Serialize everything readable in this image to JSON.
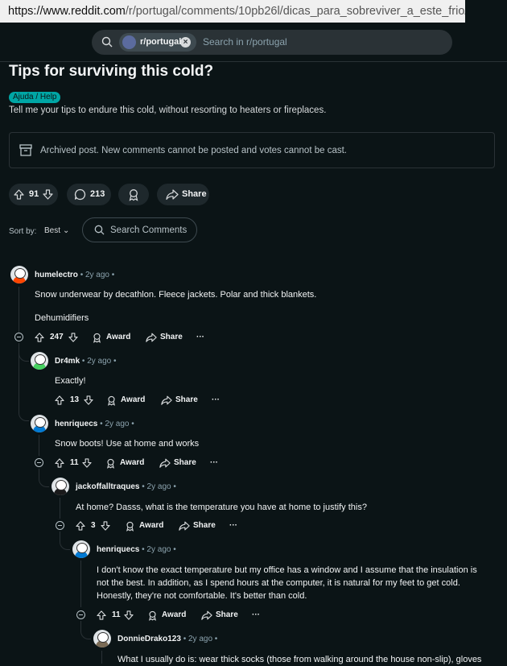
{
  "browser": {
    "url_host": "https://www.reddit.com",
    "url_path": "/r/portugal/comments/10pb26l/dicas_para_sobreviver_a_este_frio/"
  },
  "header": {
    "community": "r/portugal",
    "search_placeholder": "Search in r/portugal"
  },
  "post": {
    "title": "Tips for surviving this cold?",
    "flair": "Ajuda / Help",
    "body": "Tell me your tips to endure this cold, without resorting to heaters or fireplaces.",
    "archived_notice": "Archived post. New comments cannot be posted and votes cannot be cast.",
    "votes": "91",
    "comments": "213",
    "share_label": "Share"
  },
  "sort": {
    "label": "Sort by:",
    "value": "Best",
    "search_placeholder": "Search Comments"
  },
  "labels": {
    "award": "Award",
    "share": "Share",
    "more": "···"
  },
  "comments": [
    {
      "user": "humelectro",
      "age": "• 2y ago •",
      "text": "Snow underwear by decathlon. Fleece jackets. Polar and thick blankets.",
      "text2": "Dehumidifiers",
      "votes": "247"
    },
    {
      "user": "Dr4mk",
      "age": "• 2y ago •",
      "text": "Exactly!",
      "votes": "13"
    },
    {
      "user": "henriquecs",
      "age": "• 2y ago •",
      "text": "Snow boots! Use at home and works",
      "votes": "11"
    },
    {
      "user": "jackoffalltraques",
      "age": "• 2y ago •",
      "text": "At home? Dasss, what is the temperature you have at home to justify this?",
      "votes": "3"
    },
    {
      "user": "henriquecs",
      "age": "• 2y ago •",
      "text": "I don't know the exact temperature but my office has a window and I assume that the insulation is not the best. In addition, as I spend hours at the computer, it is natural for my feet to get cold. Honestly, they're not comfortable. It's better than cold.",
      "votes": "11"
    },
    {
      "user": "DonnieDrako123",
      "age": "• 2y ago •",
      "text": "What I usually do is: wear thick socks (those from walking around the house non-slip), gloves"
    }
  ]
}
